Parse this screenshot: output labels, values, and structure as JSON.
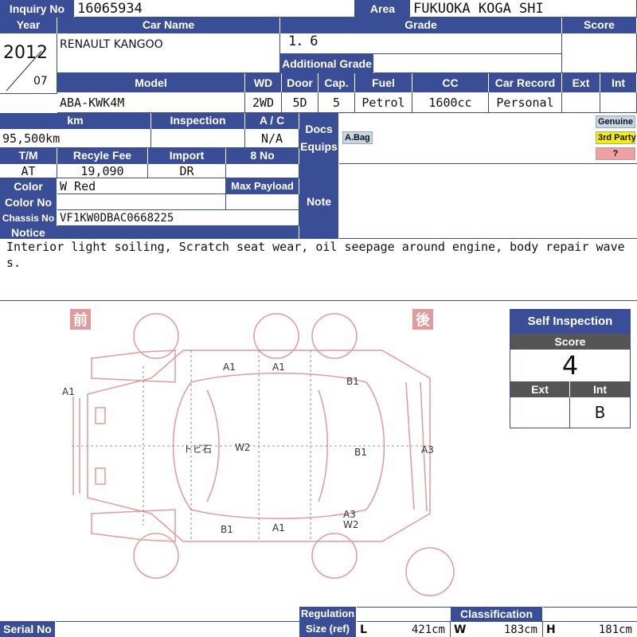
{
  "header": {
    "inquiry_label": "Inquiry No",
    "inquiry_value": "16065934",
    "area_label": "Area",
    "area_value": "FUKUOKA KOGA SHI"
  },
  "row1": {
    "year_label": "Year",
    "car_name_label": "Car Name",
    "grade_label": "Grade",
    "score_label": "Score",
    "year": "2012",
    "month": "07",
    "car_name": "RENAULT KANGOO",
    "grade": "1．6",
    "additional_grade_label": "Additional Grade"
  },
  "model_row": {
    "model_label": "Model",
    "wd_label": "WD",
    "door_label": "Door",
    "cap_label": "Cap.",
    "fuel_label": "Fuel",
    "cc_label": "CC",
    "car_record_label": "Car Record",
    "ext_label": "Ext",
    "int_label": "Int",
    "model": "ABA-KWK4M",
    "wd": "2WD",
    "door": "5D",
    "cap": "5",
    "fuel": "Petrol",
    "cc": "1600cc",
    "car_record": "Personal"
  },
  "specs": {
    "km_label": "km",
    "inspection_label": "Inspection",
    "ac_label": "A / C",
    "docs_label": "Docs",
    "equips_label": "Equips",
    "km": "95,500km",
    "ac": "N/A",
    "tm_label": "T/M",
    "recycle_label": "Recyle Fee",
    "import_label": "Import",
    "eight_label": "8 No",
    "tm": "AT",
    "recycle": "19,090",
    "import": "DR",
    "color_label": "Color",
    "color": "W Red",
    "max_payload_label": "Max Payload",
    "color_no_label": "Color No",
    "chassis_label": "Chassis No",
    "chassis": "VF1KW0DBAC0668225",
    "note_label": "Note",
    "notice_label": "Notice"
  },
  "equips": {
    "abag": "A.Bag"
  },
  "legend": {
    "genuine": "Genuine",
    "third_party": "3rd Party",
    "unknown": "?",
    "genuine_color": "#c8d7e8",
    "third_color": "#f5f000",
    "unknown_color": "#f0a0a0"
  },
  "notice_text": "Interior light soiling, Scratch seat wear, oil seepage around engine, body repair waves.",
  "diagram": {
    "front_kanji": "前",
    "rear_kanji": "後",
    "marks": [
      "A1",
      "A1",
      "A1",
      "B1",
      "トビ石",
      "W2",
      "B1",
      "A3",
      "A3",
      "W2",
      "B1",
      "A1"
    ]
  },
  "self_inspection": {
    "title": "Self Inspection",
    "score_label": "Score",
    "score": "4",
    "ext_label": "Ext",
    "int_label": "Int",
    "ext": "",
    "int": "B"
  },
  "footer": {
    "serial_label": "Serial No",
    "regulation_label": "Regulation",
    "size_label": "Size (ref)",
    "classification_label": "Classification",
    "l_label": "L",
    "l": "421cm",
    "w_label": "W",
    "w": "183cm",
    "h_label": "H",
    "h": "181cm"
  }
}
